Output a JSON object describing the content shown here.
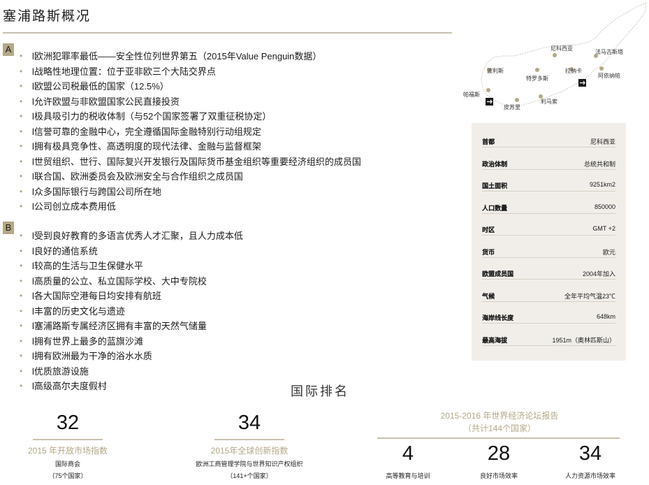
{
  "title": "塞浦路斯概况",
  "sections": [
    {
      "badge": "A",
      "points": [
        "l欧洲犯罪率最低——安全性位列世界第五（2015年Value Penguin数据）",
        "l战略性地理位置：位于亚非欧三个大陆交界点",
        "l欧盟公司税最低的国家（12.5%）",
        "l允许欧盟与非欧盟国家公民直接投资",
        "l极具吸引力的税收体制（与52个国家签署了双重征税协定）",
        "l信誉可靠的金融中心，完全遵循国际金融特别行动组规定",
        "l拥有极具竞争性、高透明度的现代法律、金融与监督框架",
        "l世贸组织、世行、国际复兴开发银行及国际货币基金组织等重要经济组织的成员国",
        "l联合国、欧洲委员会及欧洲安全与合作组织之成员国",
        "l众多国际银行与跨国公司所在地",
        "l公司创立成本费用低"
      ]
    },
    {
      "badge": "B",
      "points": [
        "l受到良好教育的多语言优秀人才汇聚，且人力成本低",
        "l良好的通信系统",
        "l较高的生活与卫生保健水平",
        "l高质量的公立、私立国际学校、大中专院校",
        "l各大国际空港每日均安排有航班",
        "l丰富的历史文化与遗迹",
        "l塞浦路斯专属经济区拥有丰富的天然气储量",
        "l拥有世界上最多的蓝旗沙滩",
        "l拥有欧洲最为干净的浴水水质",
        "l优质旅游设施",
        "l高级高尔夫度假村"
      ]
    }
  ],
  "map": {
    "cities": [
      "尼科西亚",
      "法马古斯塔",
      "阿依纳帕",
      "拉纳卡",
      "波利斯",
      "特罗多斯",
      "帕福斯",
      "皮苏里",
      "利马索"
    ]
  },
  "facts": [
    {
      "key": "首都",
      "value": "尼科西亚"
    },
    {
      "key": "政治体制",
      "value": "总统共和制"
    },
    {
      "key": "国土面积",
      "value": "9251km2"
    },
    {
      "key": "人口数量",
      "value": "850000"
    },
    {
      "key": "时区",
      "value": "GMT +2"
    },
    {
      "key": "货币",
      "value": "欧元"
    },
    {
      "key": "欧盟成员国",
      "value": "2004年加入"
    },
    {
      "key": "气候",
      "value": "全年平均气温23℃"
    },
    {
      "key": "海岸线长度",
      "value": "648km"
    },
    {
      "key": "最高海拔",
      "value": "1951m（奥林匹斯山）"
    }
  ],
  "rankings": {
    "title": "国际排名",
    "open_market": {
      "value": "32",
      "label": "2015 年开放市场指数",
      "source": "国际商会",
      "note": "（75个国家）"
    },
    "innovation": {
      "value": "34",
      "label": "2015年全球创新指数",
      "source": "欧洲工商管理学院与世界知识产权组织",
      "note": "（141+个国家）"
    },
    "wef": {
      "label": "2015-2016 年世界经济论坛报告",
      "note": "（共计144个国家）",
      "items": [
        {
          "value": "4",
          "label": "高等教育与培训"
        },
        {
          "value": "28",
          "label": "良好市场效率"
        },
        {
          "value": "34",
          "label": "人力资源市场效率"
        }
      ]
    }
  },
  "colors": {
    "accent": "#b3a888",
    "panel": "#f1eeea",
    "rule": "#c9c0ad"
  }
}
